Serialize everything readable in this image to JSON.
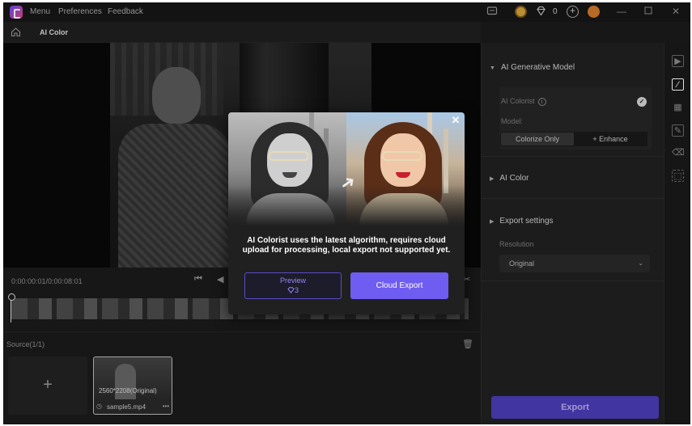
{
  "window": {
    "menu": [
      "Menu",
      "Preferences",
      "Feedback"
    ],
    "gem_count": "0"
  },
  "toolbar": {
    "title": "AI Color"
  },
  "player": {
    "timecode": "0:00:00:01/0:00:08:01"
  },
  "source": {
    "title": "Source(1/1)",
    "add_label": "+",
    "clip": {
      "resolution": "2560*2208(Original)",
      "name": "sample5.mp4"
    }
  },
  "panel": {
    "generative_section": "AI Generative Model",
    "colorist_label": "AI Colorist",
    "model_label": "Model:",
    "model_options": [
      "Colorize Only",
      "+ Enhance"
    ],
    "model_selected": "Colorize Only",
    "color_section": "AI Color",
    "export_section": "Export settings",
    "resolution_label": "Resolution",
    "resolution_value": "Original",
    "export_button": "Export"
  },
  "modal": {
    "message": "AI Colorist uses the latest algorithm, requires cloud upload for processing, local export not supported yet.",
    "preview_label": "Preview",
    "preview_cost": "3",
    "cloud_export_label": "Cloud Export"
  },
  "colors": {
    "accent": "#6f5cf0",
    "accent_dark": "#4b3db8",
    "background": "#1b1b1b"
  },
  "icons": {
    "titlebar": [
      "app-logo-icon",
      "chat-icon",
      "coin-icon",
      "gem-icon",
      "plus-circle-icon",
      "avatar-icon",
      "minimize-icon",
      "maximize-icon",
      "close-icon"
    ],
    "strip": [
      "video-icon",
      "slash-icon",
      "grid-icon",
      "edit-icon",
      "eraser-icon",
      "select-icon"
    ]
  }
}
